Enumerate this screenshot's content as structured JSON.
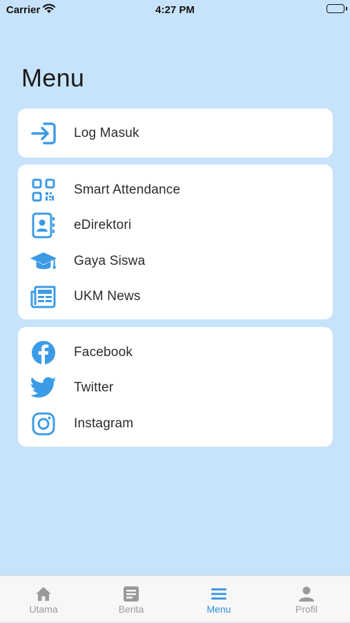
{
  "status_bar": {
    "carrier": "Carrier",
    "time": "4:27 PM"
  },
  "title": "Menu",
  "login_section": {
    "items": [
      {
        "label": "Log Masuk",
        "icon": "login-icon"
      }
    ]
  },
  "features_section": {
    "items": [
      {
        "label": "Smart Attendance",
        "icon": "qr-code-icon"
      },
      {
        "label": "eDirektori",
        "icon": "contact-book-icon"
      },
      {
        "label": "Gaya Siswa",
        "icon": "graduation-cap-icon"
      },
      {
        "label": "UKM News",
        "icon": "newspaper-icon"
      }
    ]
  },
  "social_section": {
    "items": [
      {
        "label": "Facebook",
        "icon": "facebook-icon"
      },
      {
        "label": "Twitter",
        "icon": "twitter-icon"
      },
      {
        "label": "Instagram",
        "icon": "instagram-icon"
      }
    ]
  },
  "tabbar": {
    "tabs": [
      {
        "label": "Utama",
        "icon": "home-icon"
      },
      {
        "label": "Berita",
        "icon": "news-icon"
      },
      {
        "label": "Menu",
        "icon": "menu-icon",
        "active": true
      },
      {
        "label": "Profil",
        "icon": "profile-icon"
      }
    ]
  },
  "colors": {
    "background": "#c7e3fb",
    "accent": "#2f8fe0",
    "inactive": "#9a9a9a",
    "card": "#ffffff"
  }
}
